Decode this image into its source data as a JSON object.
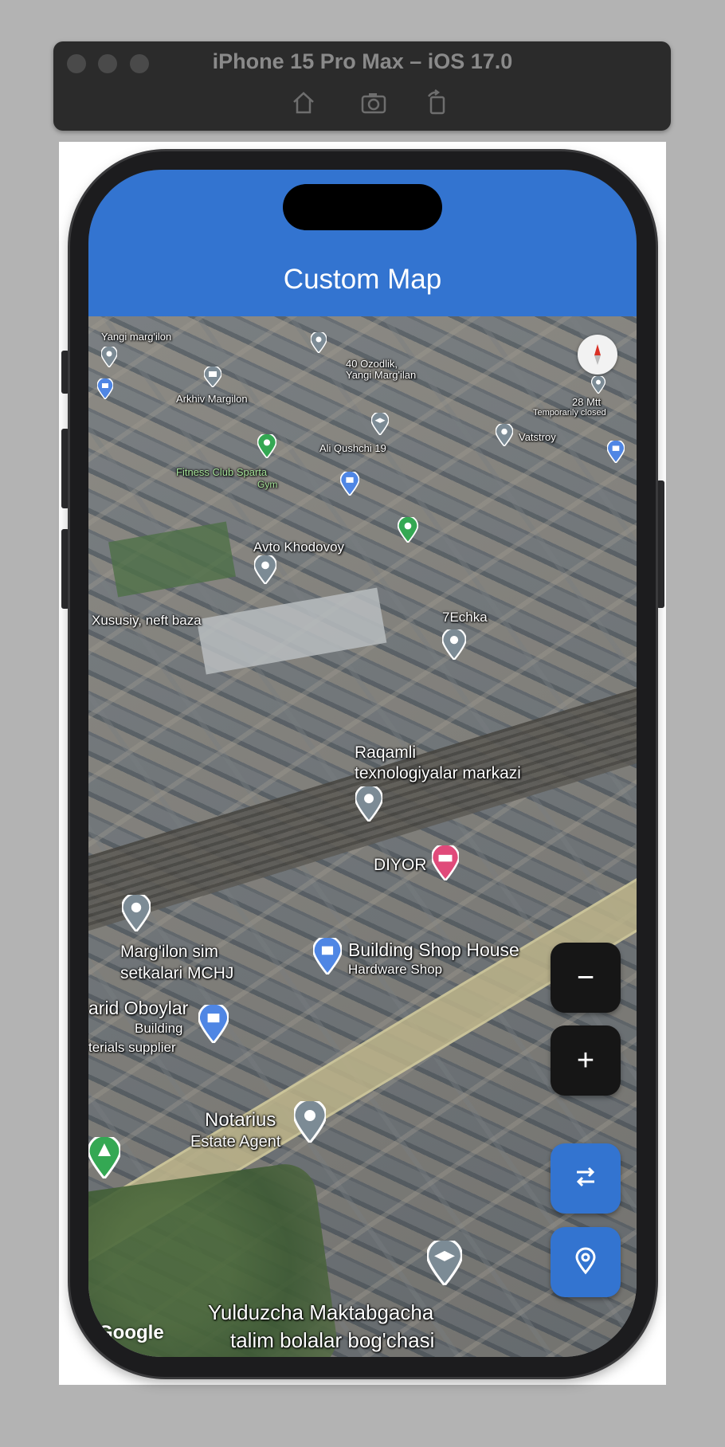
{
  "simulator": {
    "title": "iPhone 15 Pro Max – iOS 17.0",
    "toolbar_icons": [
      "home-icon",
      "screenshot-icon",
      "rotate-icon"
    ]
  },
  "app": {
    "title": "Custom Map",
    "accent_color": "#3374d0"
  },
  "map": {
    "attribution": "Google",
    "labels": {
      "yangi_marg": "Yangi marg'ilon",
      "ozodlik": "40 Ozodlik,",
      "yangi_margilan": "Yangi Marg'ilan",
      "arkhiv": "Arkhiv Margilon",
      "mtt": "28 Mtt",
      "temp_closed": "Temporarily closed",
      "vatstroy": "Vatstroy",
      "ali": "Ali Qushchi 19",
      "fitness": "Fitness Club Sparta",
      "gym": "Gym",
      "avto": "Avto Khodovoy",
      "xususiy": "Xususiy, neft baza",
      "echka": "7Echka",
      "raqamli1": "Raqamli",
      "raqamli2": "texnologiyalar markazi",
      "diyor": "DIYOR",
      "marg1": "Marg'ilon sim",
      "marg2": "setkalari MCHJ",
      "bsh": "Building Shop House",
      "hardware": "Hardware Shop",
      "farid": "arid Oboylar",
      "building": "Building",
      "materials": "terials supplier",
      "notarius": "Notarius",
      "estate": "Estate Agent",
      "yulduz1": "Yulduzcha Maktabgacha",
      "yulduz2": "talim bolalar bog'chasi"
    }
  },
  "controls": {
    "zoom_out": "−",
    "zoom_in": "+",
    "toggle_icon": "swap-icon",
    "location_icon": "location-pin-icon"
  }
}
